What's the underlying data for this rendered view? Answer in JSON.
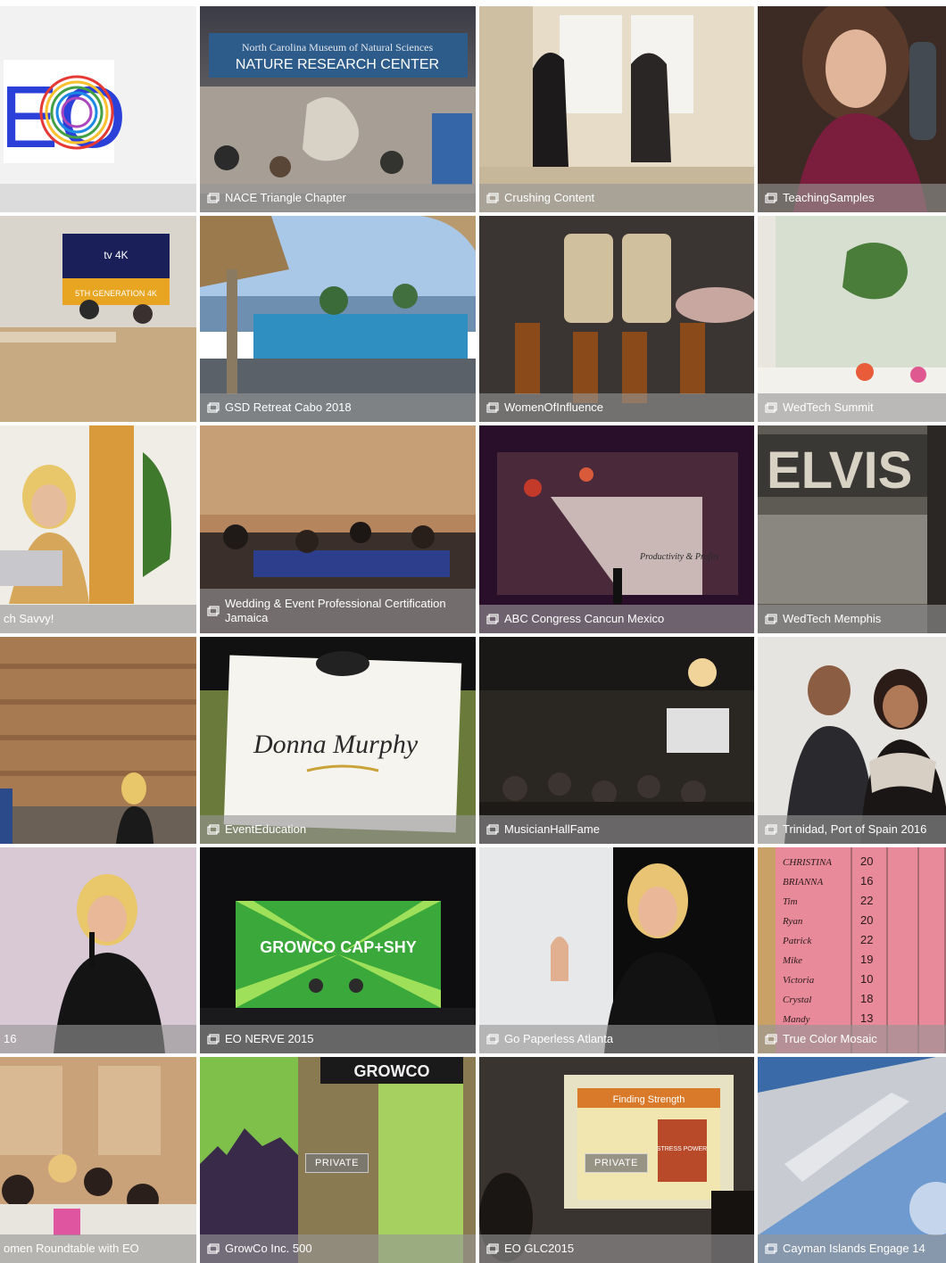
{
  "gallery": {
    "tiles": [
      {
        "caption": "",
        "logo_text": "EO"
      },
      {
        "caption": "NACE Triangle Chapter",
        "sign_line1": "North Carolina Museum of Natural Sciences",
        "sign_line2": "NATURE RESEARCH CENTER"
      },
      {
        "caption": "Crushing Content"
      },
      {
        "caption": "TeachingSamples"
      },
      {
        "caption": "",
        "screen_line1": "tv 4K",
        "screen_line2": "5TH GENERATION 4K"
      },
      {
        "caption": "GSD Retreat Cabo 2018"
      },
      {
        "caption": "WomenOfInfluence"
      },
      {
        "caption": "WedTech Summit"
      },
      {
        "caption": "ch Savvy!"
      },
      {
        "caption": "Wedding & Event Professional Certification Jamaica"
      },
      {
        "caption": "ABC Congress Cancun Mexico",
        "screen_text": "Productivity & Profits"
      },
      {
        "caption": "WedTech Memphis",
        "sign_text": "ELVIS"
      },
      {
        "caption": ""
      },
      {
        "caption": "EventEducation",
        "card_text": "Donna Murphy"
      },
      {
        "caption": "MusicianHallFame"
      },
      {
        "caption": "Trinidad, Port of Spain 2016"
      },
      {
        "caption": "16"
      },
      {
        "caption": "EO NERVE 2015",
        "stage_text": "GROWCO CAP+SHY"
      },
      {
        "caption": "Go Paperless Atlanta"
      },
      {
        "caption": "True Color Mosaic",
        "board_names": [
          "CHRISTINA",
          "BRIANNA",
          "Tim",
          "Ryan",
          "Patrick",
          "Mike",
          "Victoria",
          "Crystal",
          "Mandy"
        ],
        "board_scores": [
          "20",
          "16",
          "22",
          "20",
          "22",
          "19",
          "10",
          "18",
          "13"
        ]
      },
      {
        "caption": "omen Roundtable with EO"
      },
      {
        "caption": "GrowCo Inc. 500",
        "badge": "PRIVATE",
        "banner_text": "GROWCO"
      },
      {
        "caption": "EO GLC2015",
        "badge": "PRIVATE",
        "slide_title": "Finding Strength",
        "slide_book": "STRESS POWER"
      },
      {
        "caption": "Cayman Islands Engage 14"
      }
    ]
  },
  "colors": {
    "caption_bg": "#969696",
    "eo_blue": "#2b3fd9"
  },
  "icons": {
    "caption_icon": "photo-album-icon"
  }
}
